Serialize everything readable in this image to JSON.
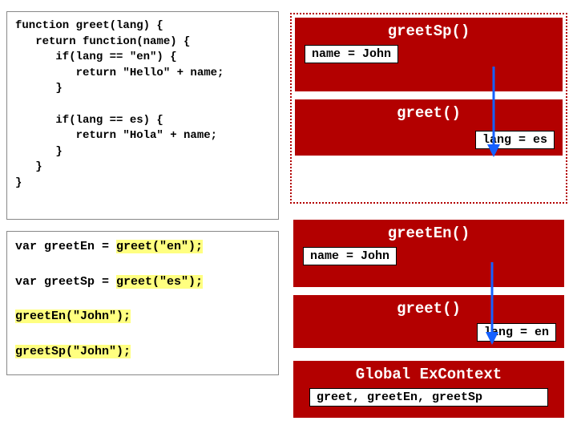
{
  "code1": "function greet(lang) {\n   return function(name) {\n      if(lang == \"en\") {\n         return \"Hello\" + name;\n      }\n\n      if(lang == es) {\n         return \"Hola\" + name;\n      }\n   }\n}",
  "code2": {
    "l1a": "var greetEn = ",
    "l1b": "greet(\"en\");",
    "l2a": "var greetSp = ",
    "l2b": "greet(\"es\");",
    "l3": "greetEn(\"John\");",
    "l4": "greetSp(\"John\");"
  },
  "stack1": {
    "a_title": "greetSp()",
    "a_var": "name = John",
    "b_title": "greet()",
    "b_var": "lang = es"
  },
  "stack2": {
    "a_title": "greetEn()",
    "a_var": "name = John",
    "b_title": "greet()",
    "b_var": "lang = en"
  },
  "global": {
    "title": "Global ExContext",
    "vars": "greet, greetEn, greetSp"
  }
}
